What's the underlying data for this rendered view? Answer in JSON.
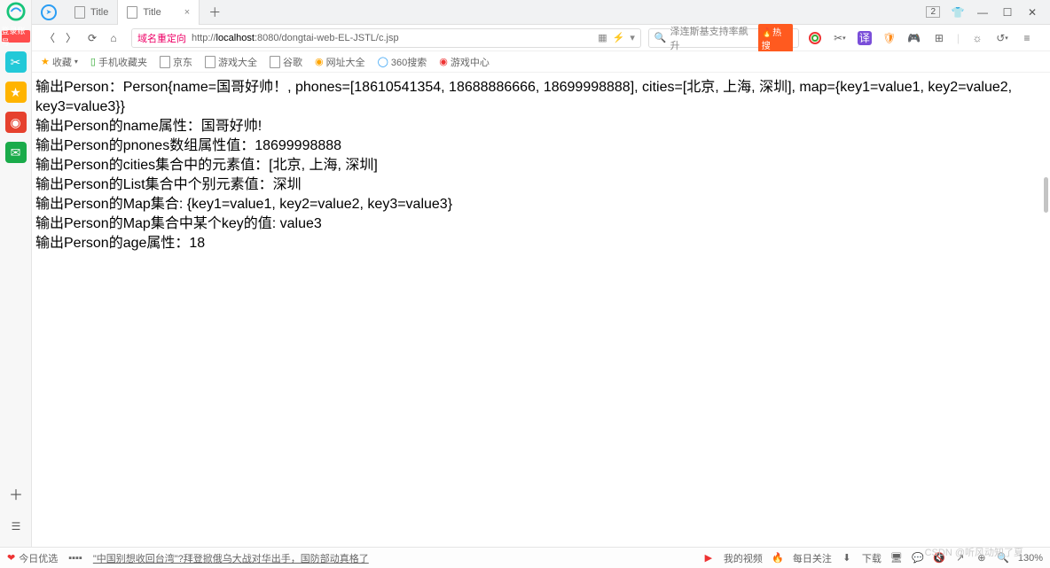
{
  "sidebar": {
    "login_badge": "登录账号",
    "icons": [
      "clip",
      "star",
      "weibo",
      "mail"
    ]
  },
  "tabs": {
    "items": [
      {
        "label": "Title",
        "active": false,
        "closable": false
      },
      {
        "label": "Title",
        "active": true,
        "closable": true
      }
    ],
    "right_count": "2"
  },
  "nav": {
    "url_prefix": "域名重定向",
    "url_host": "localhost",
    "url_port": ":8080",
    "url_path": "/dongtai-web-EL-JSTL/c.jsp",
    "url_proto": "http://",
    "hot_label": "热搜",
    "search_placeholder": "泽连斯基支持率飙升"
  },
  "bookmarks": {
    "fav_label": "收藏",
    "items": [
      {
        "label": "手机收藏夹",
        "icon": "phone"
      },
      {
        "label": "京东",
        "icon": "jd"
      },
      {
        "label": "游戏大全",
        "icon": "doc"
      },
      {
        "label": "谷歌",
        "icon": "doc"
      },
      {
        "label": "网址大全",
        "icon": "nav"
      },
      {
        "label": "360搜索",
        "icon": "360"
      },
      {
        "label": "游戏中心",
        "icon": "game"
      }
    ]
  },
  "content": {
    "line1": "输出Person：Person{name=国哥好帅！, phones=[18610541354, 18688886666, 18699998888], cities=[北京, 上海, 深圳], map={key1=value1, key2=value2, key3=value3}}",
    "line2": "输出Person的name属性：国哥好帅!",
    "line3": "输出Person的pnones数组属性值：18699998888",
    "line4": "输出Person的cities集合中的元素值：[北京, 上海, 深圳]",
    "line5": "输出Person的List集合中个别元素值：深圳",
    "line6": "输出Person的Map集合: {key1=value1, key2=value2, key3=value3}",
    "line7": "输出Person的Map集合中某个key的值: value3",
    "line8": "输出Person的age属性：18"
  },
  "status": {
    "left_label": "今日优选",
    "news": "\"中国别想收回台湾\"?拜登掀俄乌大战对华出手，国防部动真格了",
    "video_label": "我的视频",
    "follow_label": "每日关注",
    "download_label": "下载",
    "zoom": "130%"
  },
  "watermark": "CSDN @听风动知了夏"
}
